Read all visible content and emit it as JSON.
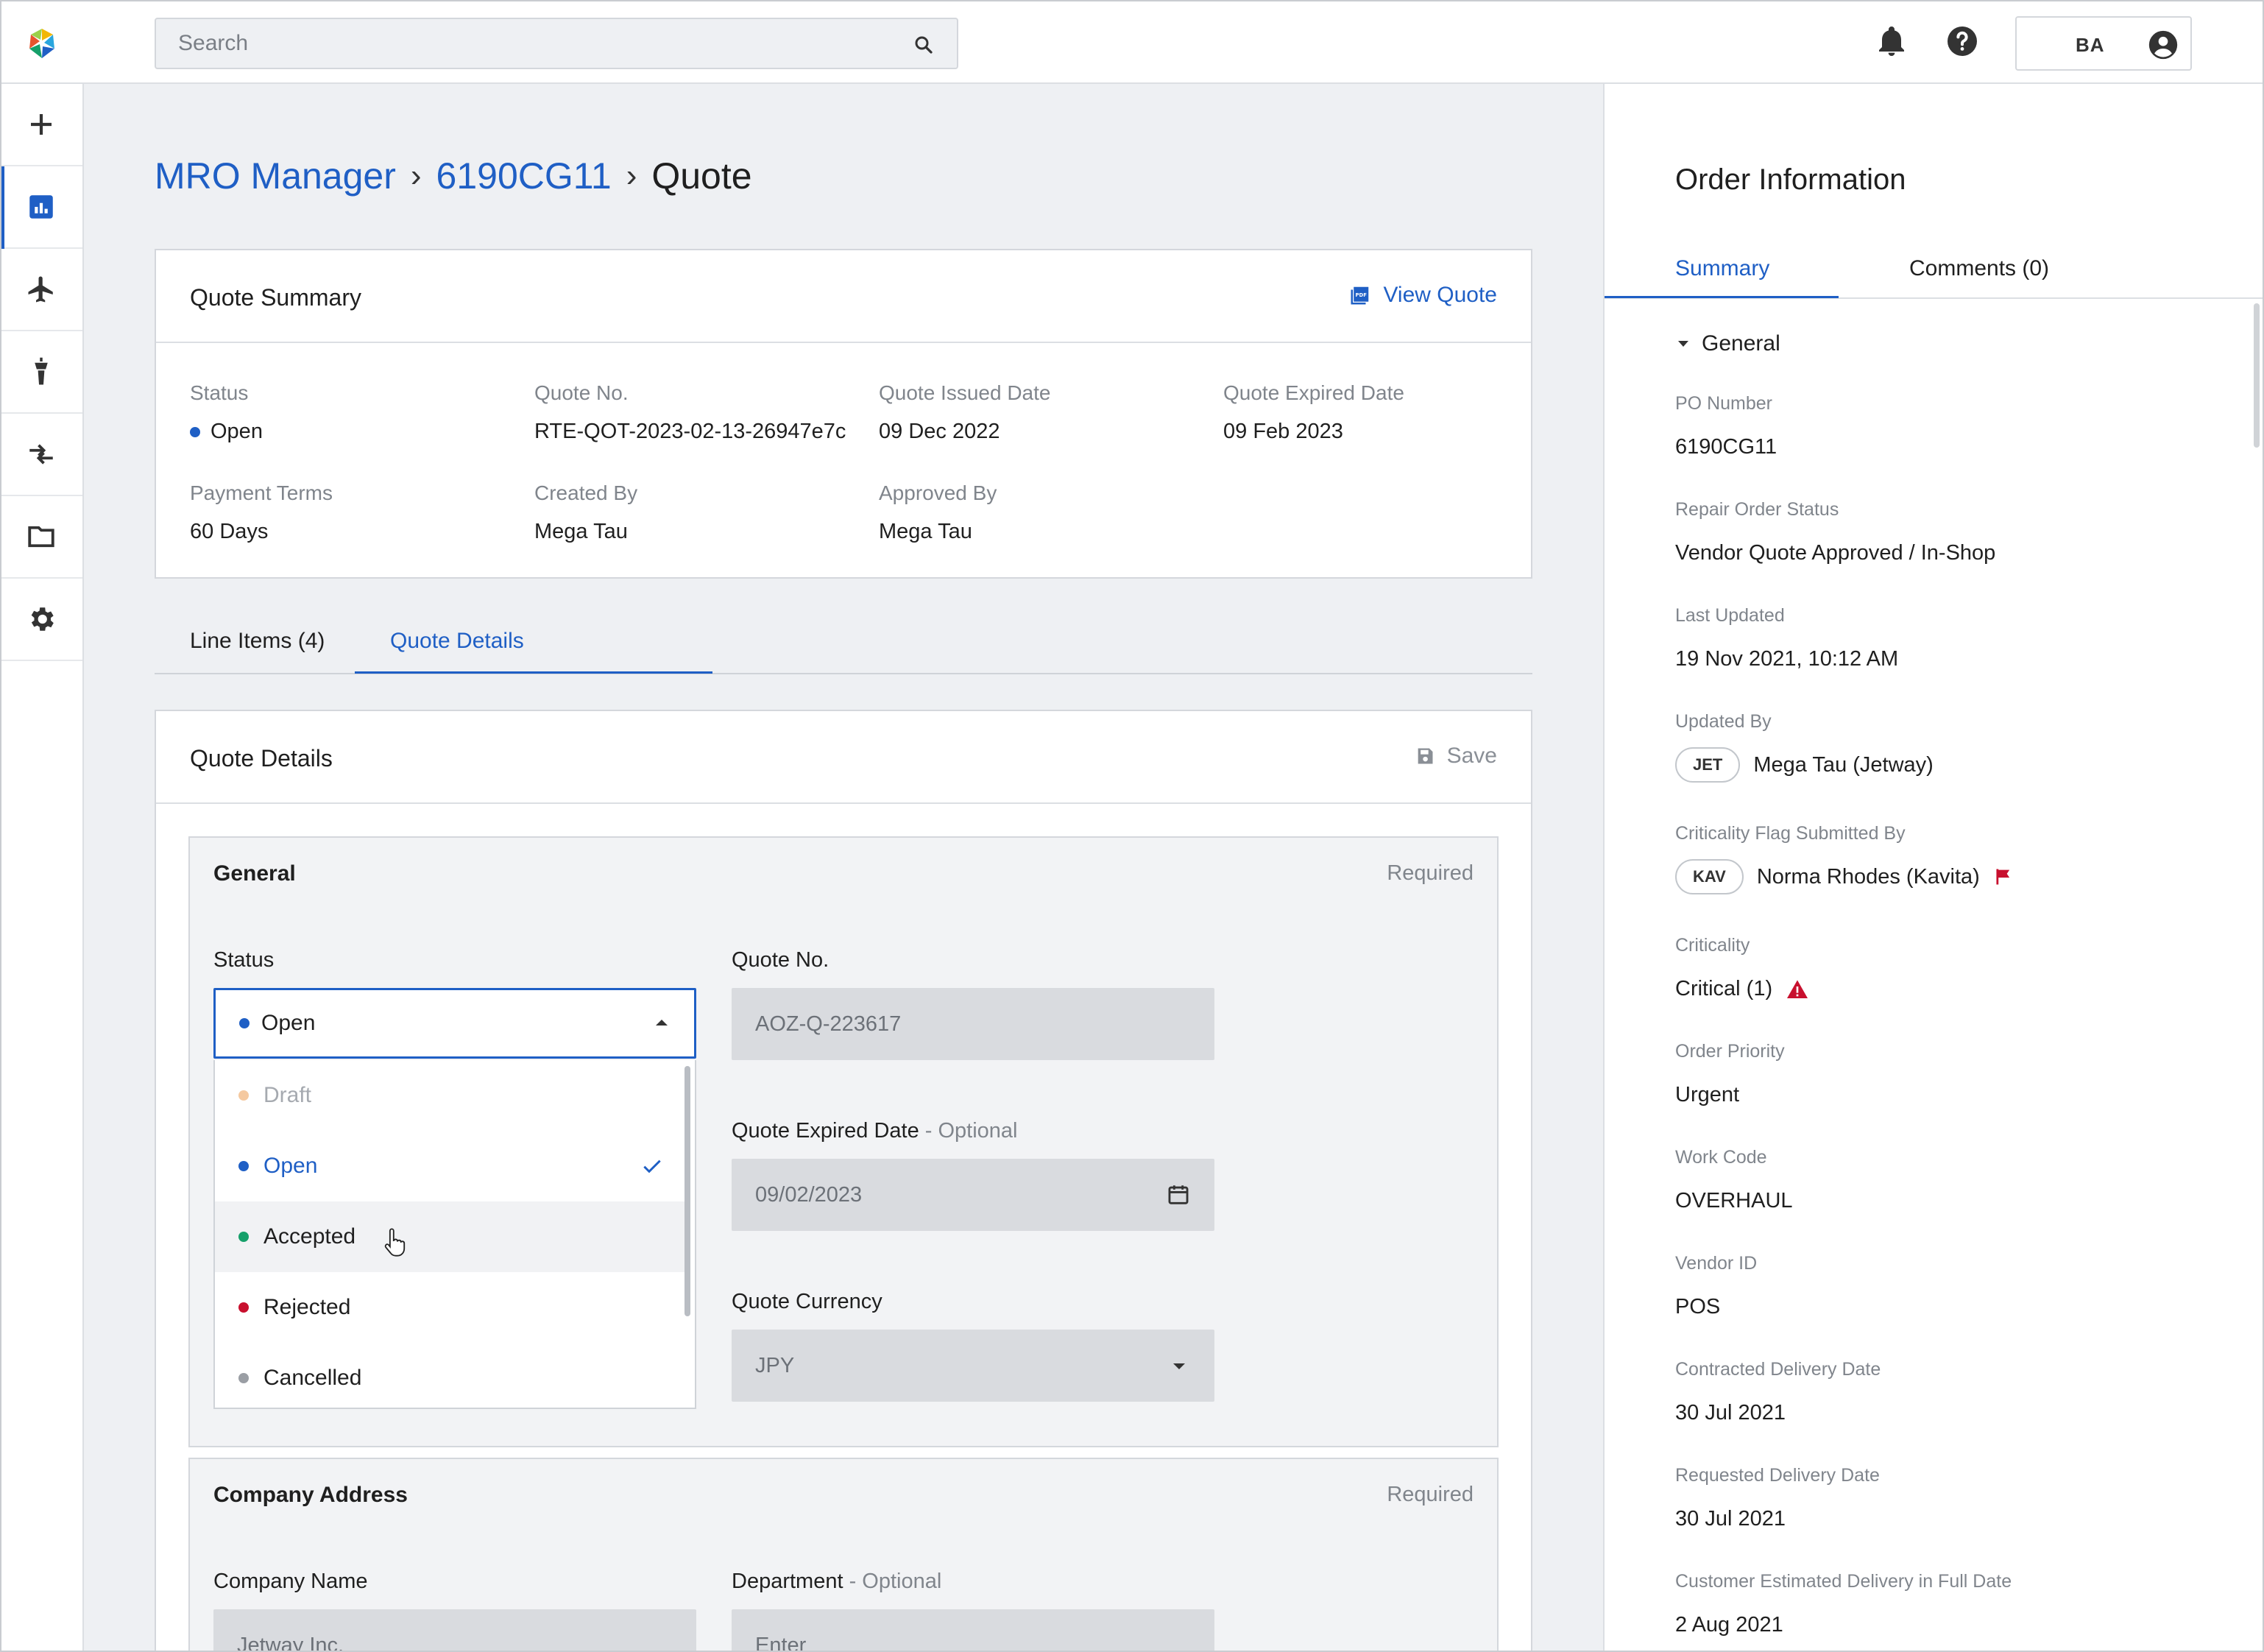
{
  "topbar": {
    "search_placeholder": "Search",
    "user_initials": "BA"
  },
  "nav": {
    "items": [
      "add-icon",
      "dashboard-icon",
      "airplane-icon",
      "tower-icon",
      "transfer-icon",
      "folder-icon",
      "settings-icon"
    ],
    "active": "dashboard-icon"
  },
  "breadcrumb": {
    "root": "MRO Manager",
    "order": "6190CG11",
    "current": "Quote",
    "separator": "›"
  },
  "quote_summary": {
    "title": "Quote Summary",
    "view_quote": "View Quote",
    "fields": [
      {
        "label": "Status",
        "value": "Open",
        "dot_color": "#1f5fc5"
      },
      {
        "label": "Quote No.",
        "value": "RTE-QOT-2023-02-13-26947e7c"
      },
      {
        "label": "Quote Issued Date",
        "value": "09 Dec 2022"
      },
      {
        "label": "Quote Expired Date",
        "value": "09 Feb 2023"
      },
      {
        "label": "Payment Terms",
        "value": "60 Days"
      },
      {
        "label": "Created By",
        "value": "Mega Tau"
      },
      {
        "label": "Approved By",
        "value": "Mega Tau"
      }
    ]
  },
  "tabs": [
    {
      "label": "Line Items (4)",
      "active": false
    },
    {
      "label": "Quote Details",
      "active": true
    }
  ],
  "quote_details": {
    "title": "Quote Details",
    "save_label": "Save",
    "general": {
      "title": "General",
      "required": "Required",
      "status_label": "Status",
      "status_value": "Open",
      "status_options": [
        {
          "label": "Draft",
          "color": "#f5c9a0",
          "disabled": true
        },
        {
          "label": "Open",
          "color": "#1f5fc5",
          "selected": true
        },
        {
          "label": "Accepted",
          "color": "#16a06a",
          "hovered": true
        },
        {
          "label": "Rejected",
          "color": "#c8102e"
        },
        {
          "label": "Cancelled",
          "color": "#9a9ea4"
        }
      ],
      "quote_no_label": "Quote No.",
      "quote_no_value": "AOZ-Q-223617",
      "expired_label": "Quote Expired Date",
      "optional": "- Optional",
      "expired_value": "09/02/2023",
      "currency_label": "Quote Currency",
      "currency_value": "JPY"
    },
    "company": {
      "title": "Company Address",
      "required": "Required",
      "company_name_label": "Company Name",
      "company_name_value": "Jetway Inc.",
      "department_label": "Department",
      "optional": "- Optional",
      "department_placeholder": "Enter"
    }
  },
  "order_info": {
    "title": "Order Information",
    "tabs": [
      "Summary",
      "Comments (0)"
    ],
    "section": "General",
    "fields": [
      {
        "label": "PO Number",
        "value": "6190CG11"
      },
      {
        "label": "Repair Order Status",
        "value": "Vendor Quote Approved / In-Shop"
      },
      {
        "label": "Last Updated",
        "value": "19 Nov 2021, 10:12 AM"
      },
      {
        "label": "Updated By",
        "chip": "JET",
        "value": "Mega Tau (Jetway)"
      },
      {
        "label": "Criticality Flag Submitted By",
        "chip": "KAV",
        "value": "Norma Rhodes (Kavita)"
      },
      {
        "label": "Criticality",
        "value": "Critical (1)"
      },
      {
        "label": "Order Priority",
        "value": "Urgent"
      },
      {
        "label": "Work Code",
        "value": "OVERHAUL"
      },
      {
        "label": "Vendor ID",
        "value": "POS"
      },
      {
        "label": "Contracted Delivery Date",
        "value": "30 Jul 2021"
      },
      {
        "label": "Requested Delivery Date",
        "value": "30 Jul 2021"
      },
      {
        "label": "Customer Estimated Delivery in Full Date",
        "value": "2 Aug 2021"
      }
    ],
    "flag_color": "#c8102e"
  }
}
